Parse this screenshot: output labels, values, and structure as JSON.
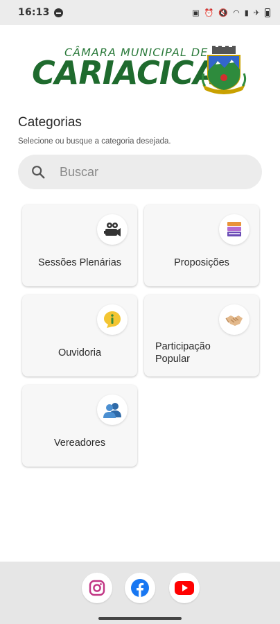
{
  "status_bar": {
    "time": "16:13"
  },
  "header": {
    "logo_top": "CÂMARA MUNICIPAL DE",
    "logo_main": "CARIACICA"
  },
  "section": {
    "title": "Categorias",
    "subtitle": "Selecione ou busque a categoria desejada."
  },
  "search": {
    "placeholder": "Buscar",
    "value": ""
  },
  "categories": [
    {
      "label": "Sessões Plenárias",
      "icon": "video-camera-icon"
    },
    {
      "label": "Proposições",
      "icon": "books-icon"
    },
    {
      "label": "Ouvidoria",
      "icon": "info-speech-icon"
    },
    {
      "label": "Participação Popular",
      "icon": "handshake-icon"
    },
    {
      "label": "Vereadores",
      "icon": "people-icon"
    }
  ],
  "social": [
    {
      "icon": "instagram-icon",
      "color": "#c13584"
    },
    {
      "icon": "facebook-icon",
      "color": "#1877f2"
    },
    {
      "icon": "youtube-icon",
      "color": "#ff0000"
    }
  ]
}
